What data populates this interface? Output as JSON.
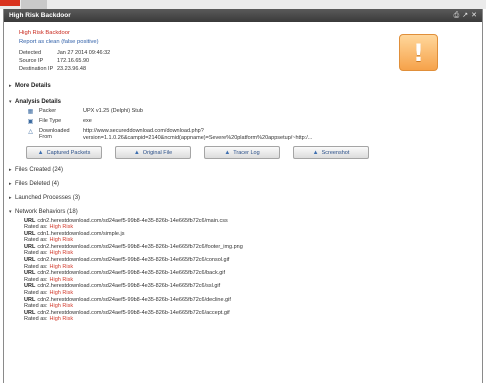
{
  "window": {
    "title": "High Risk Backdoor",
    "controls": [
      "⎙",
      "↗",
      "✕"
    ]
  },
  "alert": {
    "name": "High Risk Backdoor",
    "report_link": "Report as clean (false positive)",
    "severity_icon": "exclamation-warning-icon",
    "accent_color": "#f6a24a"
  },
  "meta": [
    {
      "label": "Detected",
      "value": "Jan 27 2014 09:46:32"
    },
    {
      "label": "Source IP",
      "value": "172.16.65.90"
    },
    {
      "label": "Destination IP",
      "value": "23.23.96.48"
    }
  ],
  "sections": {
    "more_details": "More Details",
    "analysis_details": "Analysis Details"
  },
  "analysis": [
    {
      "icon": "packer-icon",
      "label": "Packer",
      "value": "UPX v1.25 (Delphi) Stub"
    },
    {
      "icon": "file-type-icon",
      "label": "File Type",
      "value": "exe"
    },
    {
      "icon": "download-icon",
      "label": "Downloaded From",
      "value": "http://www.secureddownload.com/download.php?version=1.1.0.26&campid=2140&ncmid(appname)=Severe%20platform%20appsetup/~http:/..."
    }
  ],
  "buttons": [
    {
      "label": "Captured Packets",
      "icon": "packets-icon"
    },
    {
      "label": "Original File",
      "icon": "file-icon"
    },
    {
      "label": "Tracer Log",
      "icon": "log-icon"
    },
    {
      "label": "Screenshot",
      "icon": "screenshot-icon"
    }
  ],
  "collapsed": [
    "Files Created (24)",
    "Files Deleted (4)",
    "Launched Processes (3)"
  ],
  "network": {
    "title": "Network Behaviors (18)",
    "url_label": "URL",
    "rated_label": "Rated as:",
    "risk_color": "#d23a2c",
    "items": [
      {
        "url": "cdn2.herestdownload.com/sd24aef5-99b8-4e35-826b-14e665fb72c6/main.css",
        "rating": "High Risk"
      },
      {
        "url": "cdn1.herestdownload.com/simple.js",
        "rating": "High Risk"
      },
      {
        "url": "cdn2.herestdownload.com/sd24aef5-99b8-4e35-826b-14e665fb72c6/footer_img.png",
        "rating": "High Risk"
      },
      {
        "url": "cdn2.herestdownload.com/sd24aef5-99b8-4e35-826b-14e665fb72c6/consol.gif",
        "rating": "High Risk"
      },
      {
        "url": "cdn2.herestdownload.com/sd24aef5-99b8-4e35-826b-14e665fb72c6/back.gif",
        "rating": "High Risk"
      },
      {
        "url": "cdn2.herestdownload.com/sd24aef5-99b8-4e35-826b-14e665fb72c6/ssl.gif",
        "rating": "High Risk"
      },
      {
        "url": "cdn2.herestdownload.com/sd24aef5-99b8-4e35-826b-14e665fb72c6/decline.gif",
        "rating": "High Risk"
      },
      {
        "url": "cdn2.herestdownload.com/sd24aef5-99b8-4e35-826b-14e665fb72c6/accept.gif",
        "rating": "High Risk"
      }
    ]
  }
}
